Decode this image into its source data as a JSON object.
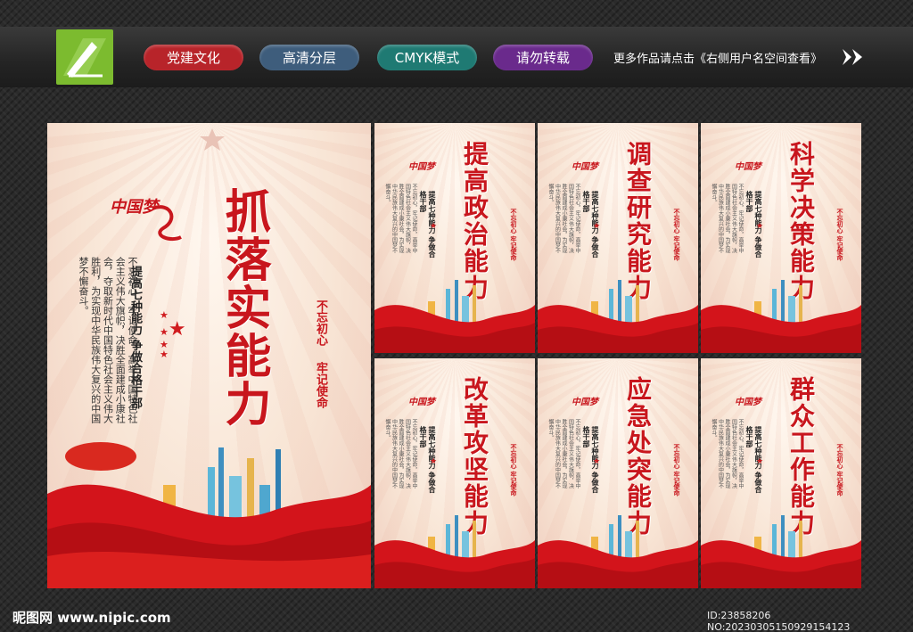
{
  "header": {
    "tags": [
      {
        "label": "党建文化",
        "color": "#b8242a"
      },
      {
        "label": "高清分层",
        "color": "#3e5d7c"
      },
      {
        "label": "CMYK模式",
        "color": "#1f7a73"
      },
      {
        "label": "请勿转载",
        "color": "#6a2a8c"
      }
    ],
    "more_text": "更多作品请点击《右侧用户名空间查看》"
  },
  "main_poster": {
    "title": "抓落实能力",
    "slogan_a": "不忘初心",
    "slogan_b": "牢记使命",
    "subtitle": "提高七种能力 争做合格干部",
    "mark": "中国梦",
    "body": "不忘初心，牢记使命，高举中国特色社会主义伟大旗帜，决胜全面建成小康社会，夺取新时代中国特色社会主义伟大胜利，为实现中华民族伟大复兴的中国梦不懈奋斗。"
  },
  "small_posters": [
    {
      "title": "提高政治能力"
    },
    {
      "title": "调查研究能力"
    },
    {
      "title": "科学决策能力"
    },
    {
      "title": "改革攻坚能力"
    },
    {
      "title": "应急处突能力"
    },
    {
      "title": "群众工作能力"
    }
  ],
  "small_common": {
    "subtitle": "提高七种能力 争做合格干部",
    "slogan": "不忘初心 牢记使命",
    "mark": "中国梦",
    "body": "不忘初心，牢记使命，高举中国特色社会主义伟大旗帜，决胜全面建成小康社会，为实现中华民族伟大复兴的中国梦不懈奋斗。"
  },
  "footer": {
    "site": "昵图网 www.nipic.com",
    "id": "ID:23858206 NO:20230305150929154123"
  },
  "colors": {
    "party_red": "#c8161d",
    "logo_green": "#7cbb2f"
  }
}
